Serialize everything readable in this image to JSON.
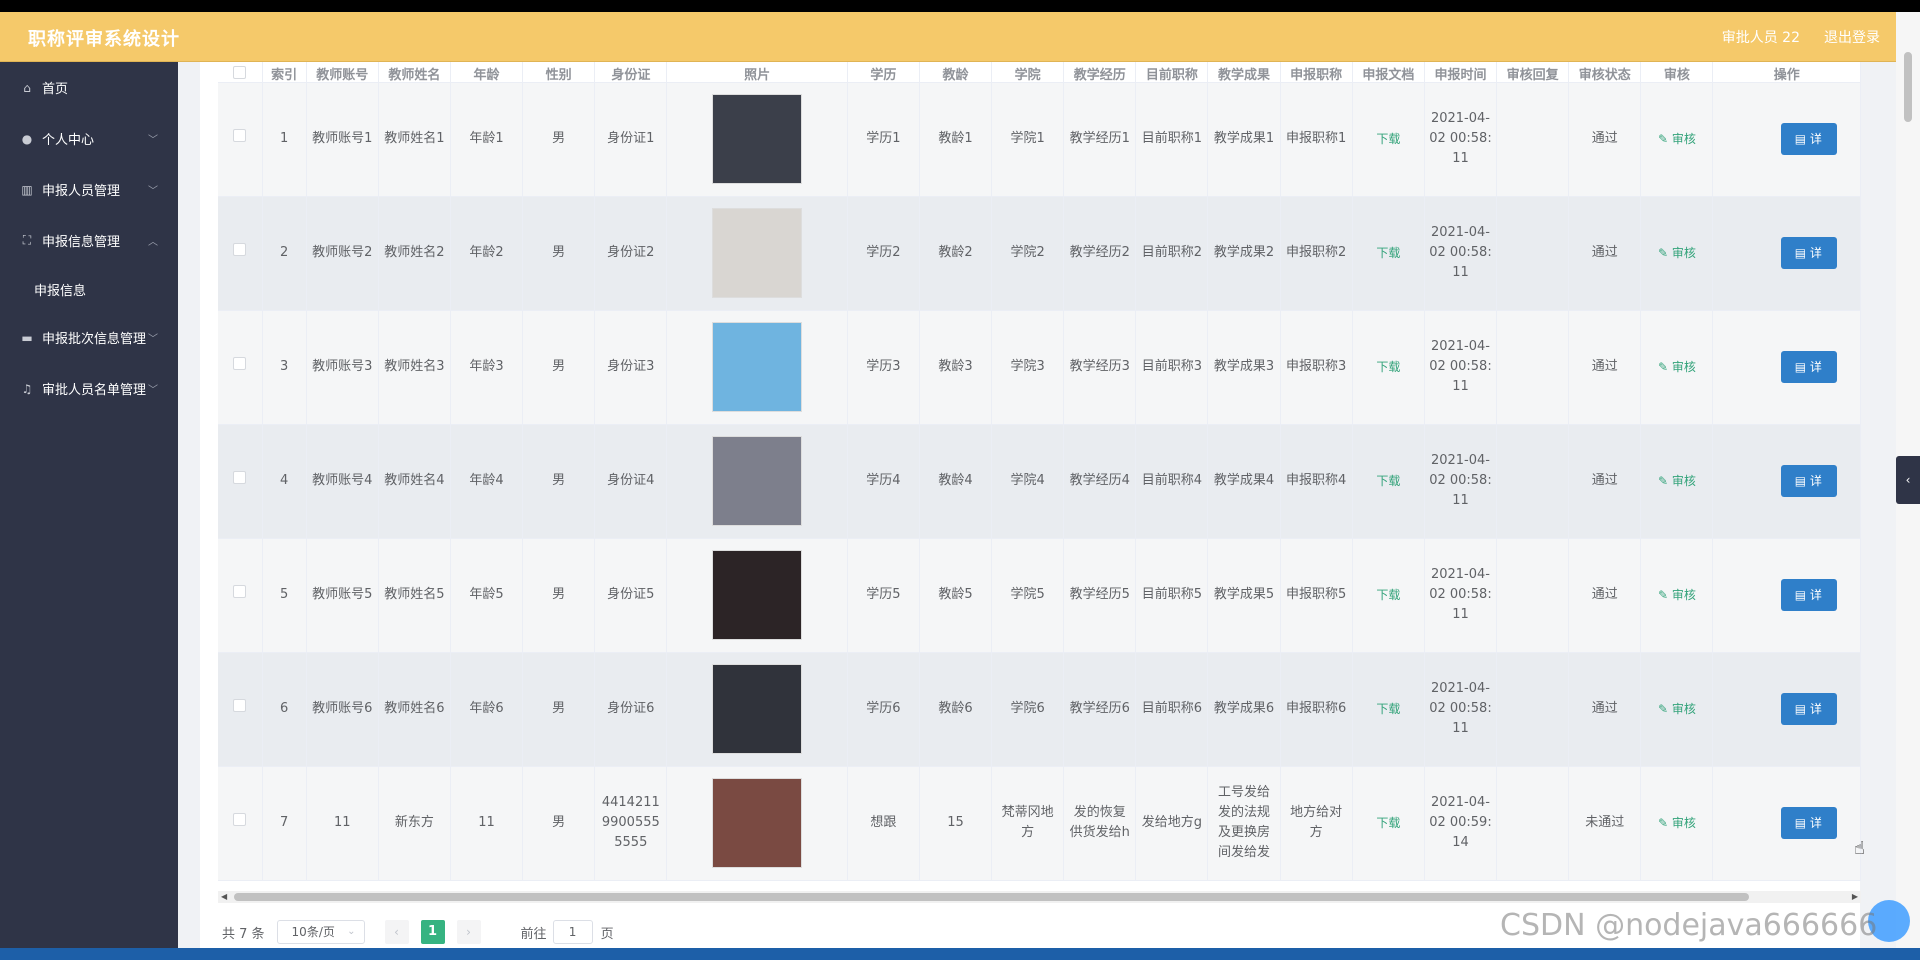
{
  "header": {
    "app_title": "职称评审系统设计",
    "user_label": "审批人员 22",
    "logout_label": "退出登录"
  },
  "sidebar": {
    "items": [
      {
        "label": "首页",
        "icon": "home-icon"
      },
      {
        "label": "个人中心",
        "icon": "user-icon"
      },
      {
        "label": "申报人员管理",
        "icon": "bar-chart-icon"
      },
      {
        "label": "申报信息管理",
        "icon": "frame-icon"
      },
      {
        "label": "申报批次信息管理",
        "icon": "comment-icon"
      },
      {
        "label": "审批人员名单管理",
        "icon": "bell-icon"
      }
    ],
    "subitem": "申报信息"
  },
  "table": {
    "headers": [
      "",
      "索引",
      "教师账号",
      "教师姓名",
      "年龄",
      "性别",
      "身份证",
      "照片",
      "学历",
      "教龄",
      "学院",
      "教学经历",
      "目前职称",
      "教学成果",
      "申报职称",
      "申报文档",
      "申报时间",
      "审核回复",
      "审核状态",
      "审核",
      "操作"
    ],
    "download_label": "下载",
    "audit_label": "审核",
    "detail_label": "详",
    "rows": [
      {
        "index": "1",
        "account": "教师账号1",
        "name": "教师姓名1",
        "age": "年龄1",
        "gender": "男",
        "idcard": "身份证1",
        "education": "学历1",
        "years": "教龄1",
        "college": "学院1",
        "experience": "教学经历1",
        "current_title": "目前职称1",
        "achievement": "教学成果1",
        "apply_title": "申报职称1",
        "time": "2021-04-02 00:58:11",
        "reply": "",
        "status": "通过",
        "photo_color": "#3b3f4a"
      },
      {
        "index": "2",
        "account": "教师账号2",
        "name": "教师姓名2",
        "age": "年龄2",
        "gender": "男",
        "idcard": "身份证2",
        "education": "学历2",
        "years": "教龄2",
        "college": "学院2",
        "experience": "教学经历2",
        "current_title": "目前职称2",
        "achievement": "教学成果2",
        "apply_title": "申报职称2",
        "time": "2021-04-02 00:58:11",
        "reply": "",
        "status": "通过",
        "photo_color": "#d9d6d2"
      },
      {
        "index": "3",
        "account": "教师账号3",
        "name": "教师姓名3",
        "age": "年龄3",
        "gender": "男",
        "idcard": "身份证3",
        "education": "学历3",
        "years": "教龄3",
        "college": "学院3",
        "experience": "教学经历3",
        "current_title": "目前职称3",
        "achievement": "教学成果3",
        "apply_title": "申报职称3",
        "time": "2021-04-02 00:58:11",
        "reply": "",
        "status": "通过",
        "photo_color": "#6fb4e0"
      },
      {
        "index": "4",
        "account": "教师账号4",
        "name": "教师姓名4",
        "age": "年龄4",
        "gender": "男",
        "idcard": "身份证4",
        "education": "学历4",
        "years": "教龄4",
        "college": "学院4",
        "experience": "教学经历4",
        "current_title": "目前职称4",
        "achievement": "教学成果4",
        "apply_title": "申报职称4",
        "time": "2021-04-02 00:58:11",
        "reply": "",
        "status": "通过",
        "photo_color": "#7d7f8c"
      },
      {
        "index": "5",
        "account": "教师账号5",
        "name": "教师姓名5",
        "age": "年龄5",
        "gender": "男",
        "idcard": "身份证5",
        "education": "学历5",
        "years": "教龄5",
        "college": "学院5",
        "experience": "教学经历5",
        "current_title": "目前职称5",
        "achievement": "教学成果5",
        "apply_title": "申报职称5",
        "time": "2021-04-02 00:58:11",
        "reply": "",
        "status": "通过",
        "photo_color": "#2c2426"
      },
      {
        "index": "6",
        "account": "教师账号6",
        "name": "教师姓名6",
        "age": "年龄6",
        "gender": "男",
        "idcard": "身份证6",
        "education": "学历6",
        "years": "教龄6",
        "college": "学院6",
        "experience": "教学经历6",
        "current_title": "目前职称6",
        "achievement": "教学成果6",
        "apply_title": "申报职称6",
        "time": "2021-04-02 00:58:11",
        "reply": "",
        "status": "通过",
        "photo_color": "#30333b"
      },
      {
        "index": "7",
        "account": "11",
        "name": "新东方",
        "age": "11",
        "gender": "男",
        "idcard": "441421199005555555",
        "education": "想跟",
        "years": "15",
        "college": "梵蒂冈地方",
        "experience": "发的恢复供货发给h",
        "current_title": "发给地方g",
        "achievement": "工号发给发的法规及更换房间发给发",
        "apply_title": "地方给对方",
        "time": "2021-04-02 00:59:14",
        "reply": "",
        "status": "未通过",
        "photo_color": "#7a4a42"
      }
    ]
  },
  "pager": {
    "total": "共 7 条",
    "page_size": "10条/页",
    "current": "1",
    "goto_prefix": "前往",
    "goto_value": "1",
    "goto_suffix": "页"
  },
  "watermark": "CSDN @nodejava666666",
  "colors": {
    "header": "#f5c96a",
    "sidebar": "#2f3447",
    "accent": "#36b381",
    "detail": "#2f7fc9"
  }
}
